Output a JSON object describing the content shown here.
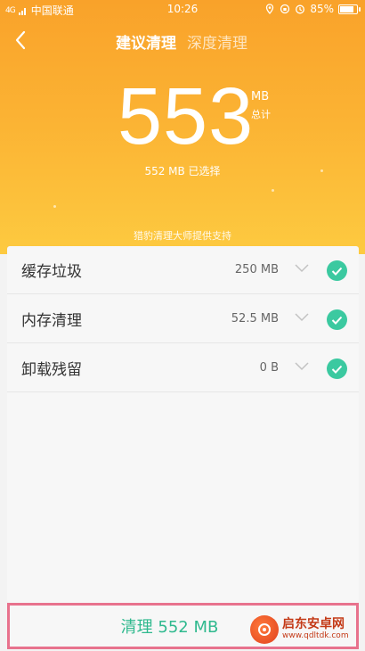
{
  "status_bar": {
    "signal": "4G",
    "carrier": "中国联通",
    "time": "10:26",
    "battery": "85%",
    "battery_level": 0.85
  },
  "header": {
    "tab_active": "建议清理",
    "tab_inactive": "深度清理"
  },
  "summary": {
    "total_value": "553",
    "total_unit": "MB",
    "total_label": "总计",
    "selected_text": "552 MB 已选择",
    "powered_by": "猎豹清理大师提供支持"
  },
  "items": [
    {
      "label": "缓存垃圾",
      "size": "250 MB",
      "checked": true
    },
    {
      "label": "内存清理",
      "size": "52.5 MB",
      "checked": true
    },
    {
      "label": "卸载残留",
      "size": "0 B",
      "checked": true
    }
  ],
  "clean_button": {
    "label": "清理 552 MB"
  },
  "colors": {
    "accent_green": "#3bc9a0",
    "header_orange": "#f9a22a",
    "highlight_border": "#e8728d"
  },
  "watermark": {
    "title": "启东安卓网",
    "url": "www.qdltdk.com"
  }
}
